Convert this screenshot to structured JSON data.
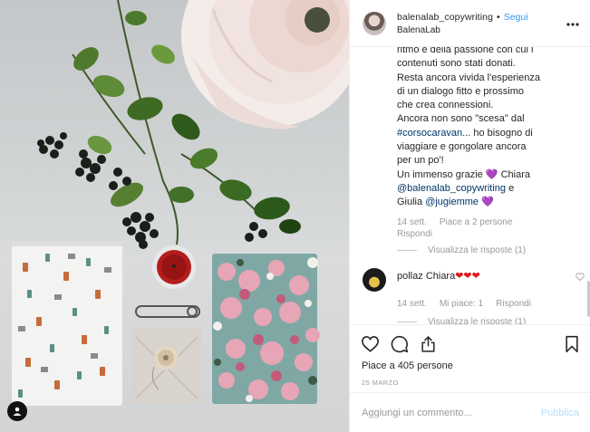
{
  "header": {
    "username": "balenalab_copywriting",
    "separator": "•",
    "follow_label": "Segui",
    "subname": "BalenaLab",
    "more_icon": "more-dots-icon"
  },
  "caption": {
    "lines": [
      "ritmo e della passione con cui i",
      "contenuti sono stati donati.",
      "Resta ancora vivida l'esperienza",
      "di un dialogo fitto e prossimo",
      "che crea connessioni.",
      "Ancora non sono \"scesa\" dal"
    ],
    "hashtag": "#corsocaravan",
    "after_hashtag": "... ho bisogno di",
    "line8": "viaggiare e gongolare ancora",
    "line9": "per un po'!",
    "line10_a": "Un immenso grazie",
    "heart": "💜",
    "line10_b": " Chiara",
    "mention1": "@balenalab_copywriting",
    "line11_b": " e",
    "line12_a": "Giulia ",
    "mention2": "@jugiemme",
    "heart2": "💜"
  },
  "caption_meta": {
    "time": "14 sett.",
    "likes": "Piace a 2 persone",
    "reply": "Rispondi",
    "view_replies": "Visualizza le risposte (1)"
  },
  "comment": {
    "user": "pollaz",
    "text": "Chiara",
    "hearts": "❤❤❤",
    "time": "14 sett.",
    "likes": "Mi piace: 1",
    "reply": "Rispondi",
    "view_replies": "Visualizza le risposte (1)"
  },
  "actions": {
    "like_icon": "heart-outline-icon",
    "comment_icon": "comment-bubble-icon",
    "share_icon": "share-icon",
    "save_icon": "bookmark-icon"
  },
  "likes_text": "Piace a 405 persone",
  "date": "25 MARZO",
  "add_comment": {
    "placeholder": "Aggiungi un commento...",
    "publish_label": "Pubblica"
  }
}
